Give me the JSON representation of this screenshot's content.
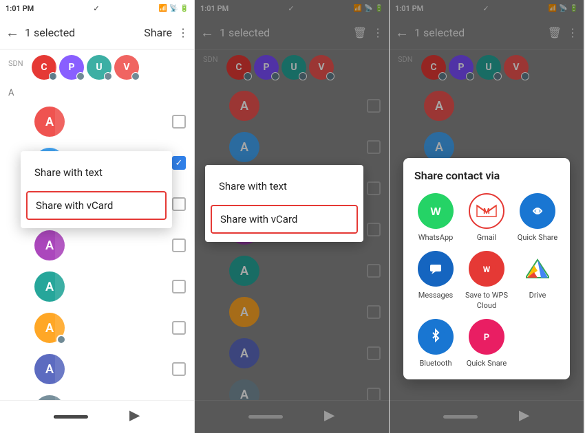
{
  "panels": [
    {
      "id": "panel1",
      "statusBar": {
        "time": "1:01 PM",
        "tick": "✓"
      },
      "toolbar": {
        "selectedText": "1 selected",
        "shareLabel": "Share"
      },
      "sdn": "SDN",
      "avatars": [
        {
          "letter": "C",
          "color": "#e53935",
          "badgeColor": "#5c6bc0"
        },
        {
          "letter": "P",
          "color": "#7c4dff",
          "badgeColor": "#607d8b"
        },
        {
          "letter": "U",
          "color": "#26a69a",
          "badgeColor": "#607d8b"
        },
        {
          "letter": "V",
          "color": "#ef5350",
          "badgeColor": "#607d8b"
        }
      ],
      "sectionA": "A",
      "contacts": [
        {
          "letter": "A",
          "color": "#ef5350",
          "checked": false
        },
        {
          "letter": "A",
          "color": "#42a5f5",
          "checked": true
        },
        {
          "letter": "A",
          "color": "#66bb6a",
          "checked": false
        },
        {
          "letter": "A",
          "color": "#ab47bc",
          "checked": false
        },
        {
          "letter": "A",
          "color": "#26a69a",
          "checked": false
        },
        {
          "letter": "A",
          "color": "#ffa726",
          "badgeColor": "#607d8b",
          "checked": false
        },
        {
          "letter": "A",
          "color": "#5c6bc0",
          "checked": false
        },
        {
          "letter": "A",
          "color": "#78909c",
          "checked": false
        }
      ],
      "shareMenu": {
        "items": [
          {
            "label": "Share with text",
            "highlighted": false
          },
          {
            "label": "Share with vCard",
            "highlighted": true
          }
        ]
      }
    },
    {
      "id": "panel2",
      "statusBar": {
        "time": "1:01 PM",
        "tick": "✓"
      },
      "toolbar": {
        "selectedText": "1 selected"
      },
      "sdn": "SDN",
      "avatars": [
        {
          "letter": "C",
          "color": "#e53935",
          "badgeColor": "#5c6bc0"
        },
        {
          "letter": "P",
          "color": "#7c4dff",
          "badgeColor": "#607d8b"
        },
        {
          "letter": "U",
          "color": "#26a69a",
          "badgeColor": "#607d8b"
        },
        {
          "letter": "V",
          "color": "#ef5350",
          "badgeColor": "#607d8b"
        }
      ],
      "contacts": [
        {
          "letter": "A",
          "color": "#ef5350",
          "checked": false
        },
        {
          "letter": "A",
          "color": "#42a5f5",
          "checked": false
        },
        {
          "letter": "A",
          "color": "#66bb6a",
          "checked": false
        },
        {
          "letter": "A",
          "color": "#ab47bc",
          "checked": false
        },
        {
          "letter": "A",
          "color": "#26a69a",
          "checked": false
        },
        {
          "letter": "A",
          "color": "#ffa726",
          "checked": false
        },
        {
          "letter": "A",
          "color": "#5c6bc0",
          "checked": false
        },
        {
          "letter": "A",
          "color": "#78909c",
          "checked": false
        }
      ],
      "shareMenu": {
        "title": "Share with text",
        "items": [
          {
            "label": "Share with text",
            "highlighted": false
          },
          {
            "label": "Share with vCard",
            "highlighted": true
          }
        ]
      }
    },
    {
      "id": "panel3",
      "statusBar": {
        "time": "1:01 PM",
        "tick": "✓"
      },
      "toolbar": {
        "selectedText": "1 selected"
      },
      "sdn": "SDN",
      "avatars": [
        {
          "letter": "C",
          "color": "#e53935",
          "badgeColor": "#5c6bc0"
        },
        {
          "letter": "P",
          "color": "#7c4dff",
          "badgeColor": "#607d8b"
        },
        {
          "letter": "U",
          "color": "#26a69a",
          "badgeColor": "#607d8b"
        },
        {
          "letter": "V",
          "color": "#ef5350",
          "badgeColor": "#607d8b"
        }
      ],
      "contacts": [
        {
          "letter": "A",
          "color": "#ef5350",
          "checked": false
        },
        {
          "letter": "A",
          "color": "#42a5f5",
          "checked": false
        },
        {
          "letter": "A",
          "color": "#66bb6a",
          "checked": false
        },
        {
          "letter": "A",
          "color": "#ab47bc",
          "checked": false
        },
        {
          "letter": "A",
          "color": "#26a69a",
          "checked": false
        },
        {
          "letter": "A",
          "color": "#ffa726",
          "checked": false
        },
        {
          "letter": "A",
          "color": "#5c6bc0",
          "checked": false
        },
        {
          "letter": "A",
          "color": "#78909c",
          "checked": false
        }
      ],
      "shareContactVia": {
        "title": "Share contact via",
        "apps": [
          {
            "name": "WhatsApp",
            "color": "#25D366",
            "icon": "W",
            "highlighted": false
          },
          {
            "name": "Gmail",
            "color": "#EA4335",
            "icon": "G",
            "highlighted": true
          },
          {
            "name": "Quick Share",
            "color": "#1976D2",
            "icon": "⟳",
            "highlighted": false
          },
          {
            "name": "Messages",
            "color": "#1565C0",
            "icon": "✉",
            "highlighted": false
          },
          {
            "name": "Save to WPS Cloud",
            "color": "#E53935",
            "icon": "W",
            "highlighted": false
          },
          {
            "name": "Drive",
            "color": "#34A853",
            "icon": "△",
            "highlighted": false
          },
          {
            "name": "Bluetooth",
            "color": "#1976D2",
            "icon": "⬡",
            "highlighted": false
          },
          {
            "name": "Quick Snare",
            "color": "#E91E63",
            "icon": "P",
            "highlighted": false
          }
        ]
      }
    }
  ]
}
